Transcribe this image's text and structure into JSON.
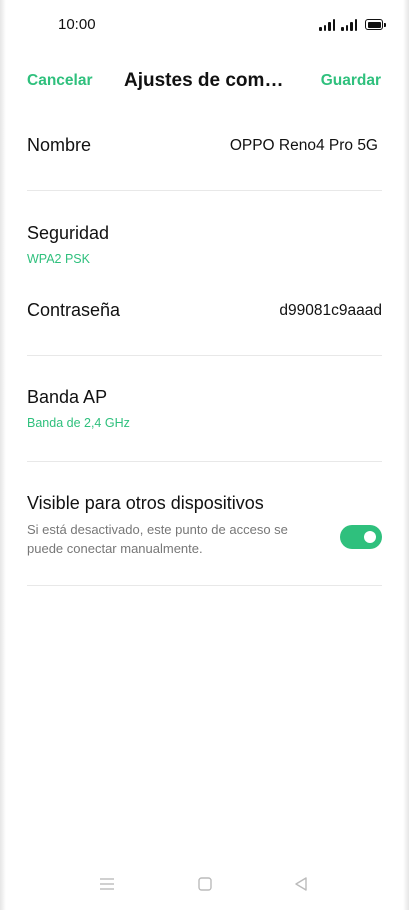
{
  "status_bar": {
    "time": "10:00"
  },
  "header": {
    "cancel_label": "Cancelar",
    "title": "Ajustes de comp…",
    "save_label": "Guardar"
  },
  "settings": {
    "name": {
      "label": "Nombre",
      "value": "OPPO Reno4 Pro 5G"
    },
    "security": {
      "label": "Seguridad",
      "value": "WPA2 PSK"
    },
    "password": {
      "label": "Contraseña",
      "value": "d99081c9aaad"
    },
    "ap_band": {
      "label": "Banda AP",
      "value": "Banda de 2,4 GHz"
    },
    "visible": {
      "label": "Visible para otros dispositivos",
      "description": "Si está desactivado, este punto de acceso se puede conectar manualmente.",
      "enabled": true
    }
  },
  "colors": {
    "accent": "#2fc07d",
    "text": "#111111",
    "secondary_text": "#777777",
    "divider": "#e8e8e8"
  },
  "icons": {
    "signal_1": "signal-icon",
    "signal_2": "signal-icon",
    "battery": "battery-icon",
    "nav_menu": "menu-icon",
    "nav_home": "home-icon",
    "nav_back": "back-icon"
  }
}
